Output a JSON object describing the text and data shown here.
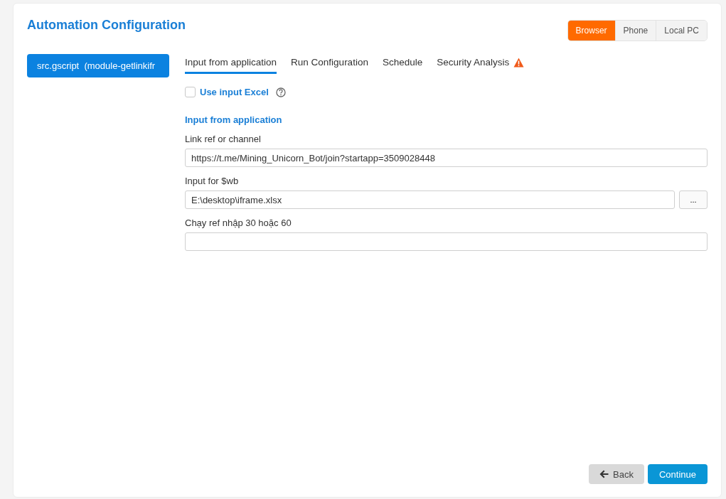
{
  "title": "Automation Configuration",
  "modes": [
    {
      "label": "Browser",
      "selected": true
    },
    {
      "label": "Phone",
      "selected": false
    },
    {
      "label": "Local PC",
      "selected": false
    }
  ],
  "sidebar": {
    "items": [
      {
        "label": "src.gscript  (module-getlinkifr",
        "selected": true
      }
    ]
  },
  "tabs": [
    {
      "label": "Input from application",
      "selected": true,
      "warning": false
    },
    {
      "label": "Run Configuration",
      "selected": false,
      "warning": false
    },
    {
      "label": "Schedule",
      "selected": false,
      "warning": false
    },
    {
      "label": "Security Analysis",
      "selected": false,
      "warning": true
    }
  ],
  "use_input_excel": {
    "label": "Use input Excel",
    "checked": false
  },
  "section_title": "Input from application",
  "fields": [
    {
      "kind": "text",
      "label": "Link ref or channel",
      "value": "https://t.me/Mining_Unicorn_Bot/join?startapp=3509028448"
    },
    {
      "kind": "file",
      "label": "Input for $wb",
      "value": "E:\\desktop\\iframe.xlsx",
      "browse": "..."
    },
    {
      "kind": "text",
      "label": "Chạy ref nhập 30 hoặc 60"
    }
  ],
  "buttons": {
    "back": "Back",
    "continue": "Continue"
  }
}
